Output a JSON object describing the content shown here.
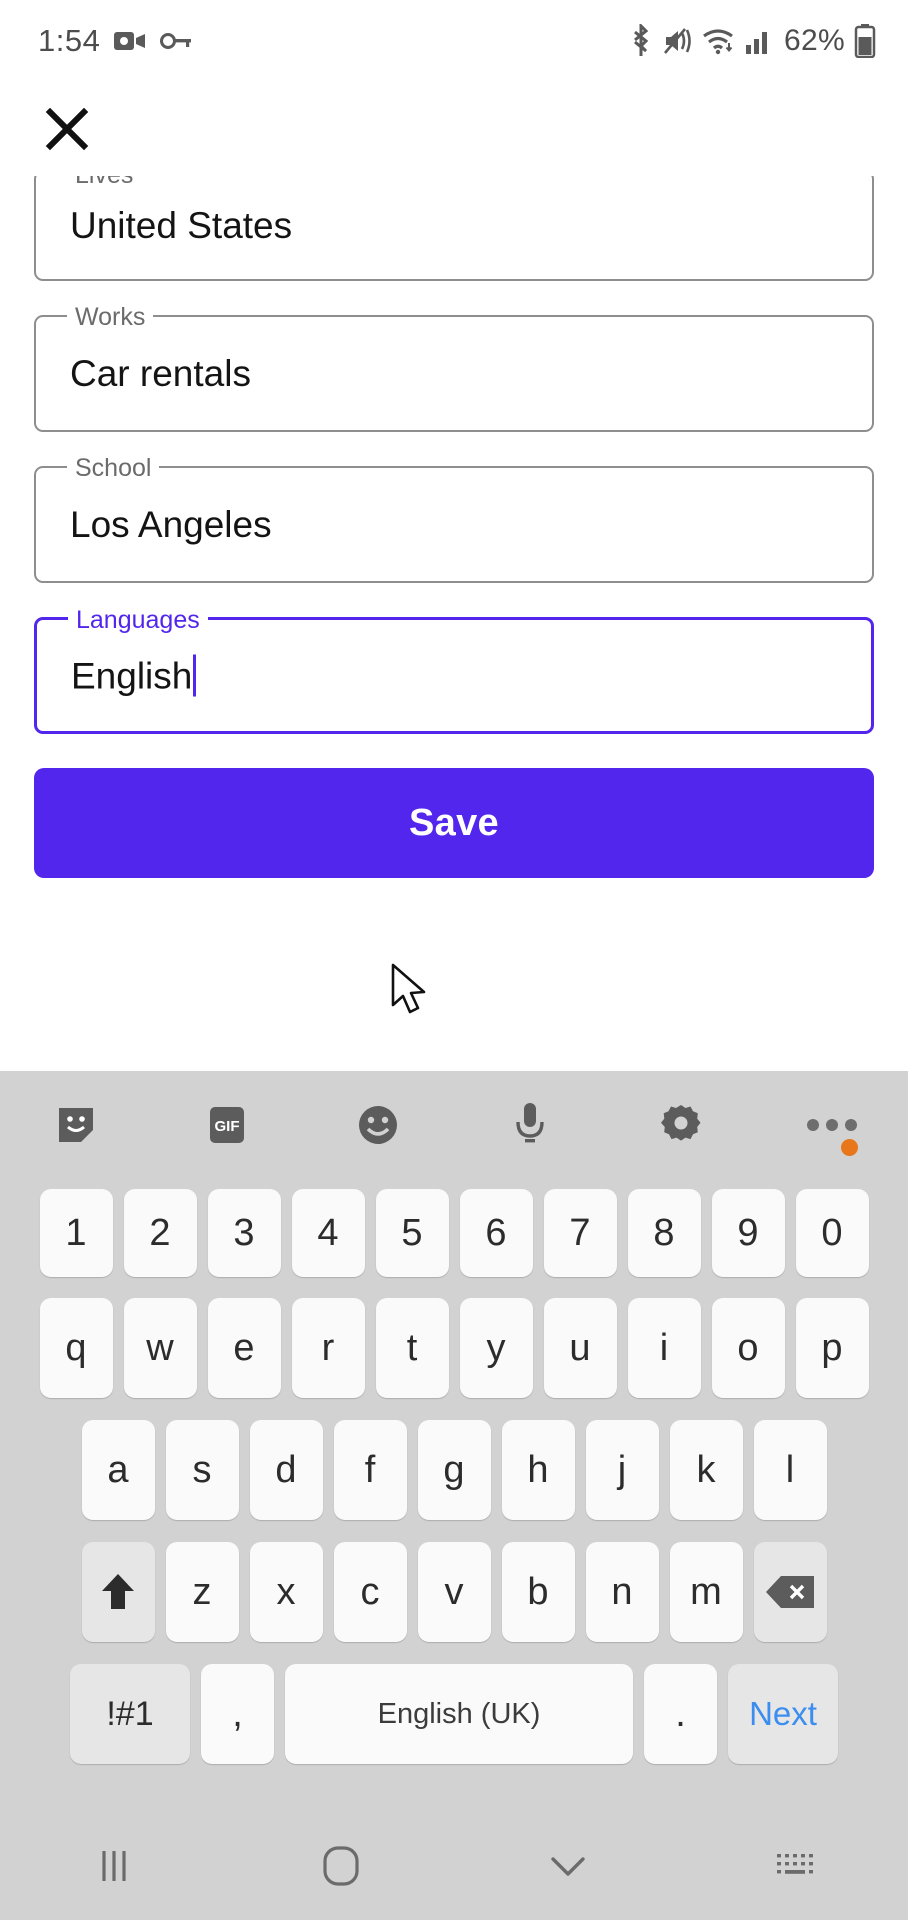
{
  "statusbar": {
    "time": "1:54",
    "battery_text": "62%",
    "icons": [
      "screen-recorder-icon",
      "vpn-key-icon",
      "bluetooth-icon",
      "mute-vibrate-icon",
      "wifi-icon",
      "cellular-signal-icon",
      "battery-icon"
    ]
  },
  "appbar": {
    "close_label": "close-icon"
  },
  "form": {
    "fields": [
      {
        "label": "Lives",
        "value": "United States",
        "focused": false,
        "clipped": true
      },
      {
        "label": "Works",
        "value": "Car rentals",
        "focused": false,
        "clipped": false
      },
      {
        "label": "School",
        "value": "Los Angeles",
        "focused": false,
        "clipped": false
      },
      {
        "label": "Languages",
        "value": "English",
        "focused": true,
        "clipped": false
      }
    ],
    "save_label": "Save"
  },
  "colors": {
    "accent": "#5226ec",
    "keyboard_bg": "#d2d2d2",
    "key_bg": "#fafafa",
    "mod_key_bg": "#e6e6e6",
    "next_key_text": "#3c8df0",
    "badge": "#e8761a",
    "field_border": "#8e8e8e"
  },
  "keyboard": {
    "toolbar": [
      {
        "name": "sticker-icon"
      },
      {
        "name": "gif-icon",
        "label": "GIF"
      },
      {
        "name": "emoji-icon"
      },
      {
        "name": "microphone-icon"
      },
      {
        "name": "settings-gear-icon"
      },
      {
        "name": "overflow-menu-icon",
        "badge": true
      }
    ],
    "rows": {
      "numbers": [
        "1",
        "2",
        "3",
        "4",
        "5",
        "6",
        "7",
        "8",
        "9",
        "0"
      ],
      "row1": [
        "q",
        "w",
        "e",
        "r",
        "t",
        "y",
        "u",
        "i",
        "o",
        "p"
      ],
      "row2": [
        "a",
        "s",
        "d",
        "f",
        "g",
        "h",
        "j",
        "k",
        "l"
      ],
      "row3": [
        "z",
        "x",
        "c",
        "v",
        "b",
        "n",
        "m"
      ]
    },
    "shift_label": "shift-icon",
    "backspace_label": "backspace-icon",
    "symbols_label": "!#1",
    "comma_label": ",",
    "space_label": "English (UK)",
    "period_label": ".",
    "next_label": "Next"
  },
  "navbar": {
    "recents_label": "recents-icon",
    "home_label": "home-icon",
    "hide_keyboard_label": "hide-keyboard-icon",
    "switch_keyboard_label": "switch-keyboard-icon"
  }
}
